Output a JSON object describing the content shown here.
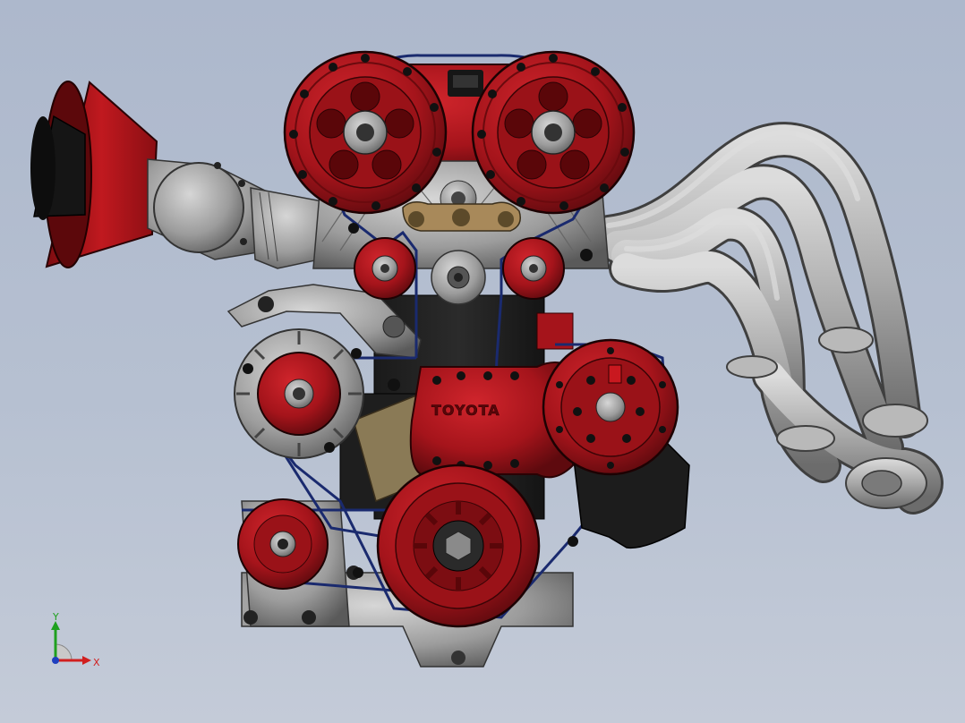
{
  "viewport": {
    "background": "#b4bed0",
    "model_label": "TOYOTA"
  },
  "triad": {
    "x_label": "X",
    "y_label": "Y",
    "x_color": "#d11f1f",
    "y_color": "#1fa01f",
    "z_color": "#1f3fbf"
  },
  "colors": {
    "pulley_red": "#a5141b",
    "metal_gray": "#9c9c9c",
    "belt_blue": "#1a2a6e",
    "exhaust_gray": "#9a9a9a"
  }
}
